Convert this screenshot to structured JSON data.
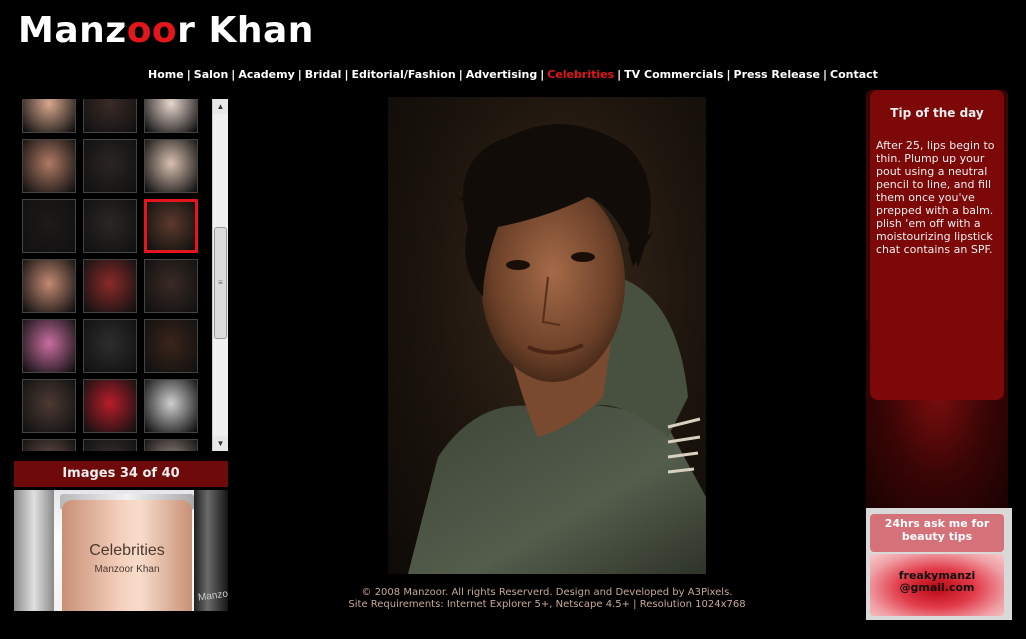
{
  "site": {
    "logo_first": "Manz",
    "logo_accent": "oo",
    "logo_last": "r Khan"
  },
  "nav": {
    "items": [
      "Home",
      "Salon",
      "Academy",
      "Bridal",
      "Editorial/Fashion",
      "Advertising",
      "Celebrities",
      "TV Commercials",
      "Press Release",
      "Contact"
    ],
    "active": "Celebrities",
    "separator": "|"
  },
  "gallery": {
    "counter": "Images 34 of 40",
    "selected_index": 8,
    "thumb_colors": [
      "#d9a88e",
      "#3b2b26",
      "#e9d8cf",
      "#b07a64",
      "#2a2522",
      "#d8c0b0",
      "#1d1a18",
      "#2b2624",
      "#5c3a2c",
      "#c48a73",
      "#8a2a2a",
      "#3a2a24",
      "#c96ea0",
      "#2d2d2d",
      "#3a241a",
      "#4d3a33",
      "#b81d2a",
      "#cfcfcf",
      "#6a5048",
      "#3a3030",
      "#9a8a80"
    ],
    "scroll_up_arrow": "▲",
    "scroll_down_arrow": "▼",
    "scroll_grip": "≡"
  },
  "promo": {
    "title": "Celebrities",
    "subtitle": "Manzoor Khan",
    "brand": "Manzoor"
  },
  "tip": {
    "title": "Tip of the day",
    "text": "After 25, lips begin to thin. Plump up your pout using a neutral pencil to line, and fill them once you've prepped with a balm. plish 'em off with a moistourizing lipstick chat contains an SPF."
  },
  "ask": {
    "heading": "24hrs ask me for beauty tips",
    "email": "freakymanzi @gmail.com"
  },
  "footer": {
    "line1": "© 2008 Manzoor. All rights Reserverd. Design and Developed by A3Pixels.",
    "line2": "Site Requirements: Internet Explorer 5+, Netscape 4.5+ | Resolution 1024x768"
  },
  "colors": {
    "accent": "#e3161c",
    "counter_bg": "#6e0a0a",
    "tip_bg": "#7c0808"
  }
}
